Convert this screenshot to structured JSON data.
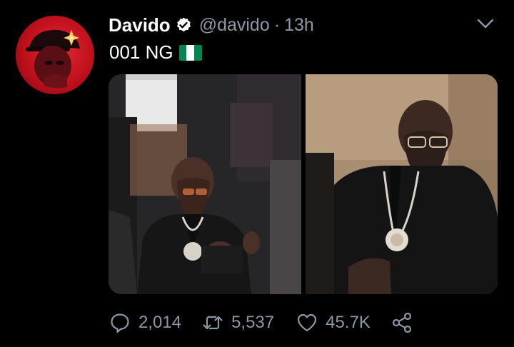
{
  "tweet": {
    "display_name": "Davido",
    "handle": "@davido",
    "separator": "·",
    "time": "13h",
    "text": "001 NG",
    "flag_icon": "nigeria-flag-icon",
    "colors": {
      "background": "#000000",
      "secondary_text": "#8b98a5",
      "primary_text": "#ffffff",
      "flag_green": "#008751",
      "avatar_red": "#d0141f"
    },
    "stats": {
      "replies": "2,014",
      "retweets": "5,537",
      "likes": "45.7K"
    },
    "icons": {
      "reply": "reply-icon",
      "retweet": "retweet-icon",
      "like": "heart-icon",
      "share": "share-icon",
      "verified": "verified-badge-icon",
      "menu": "chevron-down-icon"
    }
  }
}
